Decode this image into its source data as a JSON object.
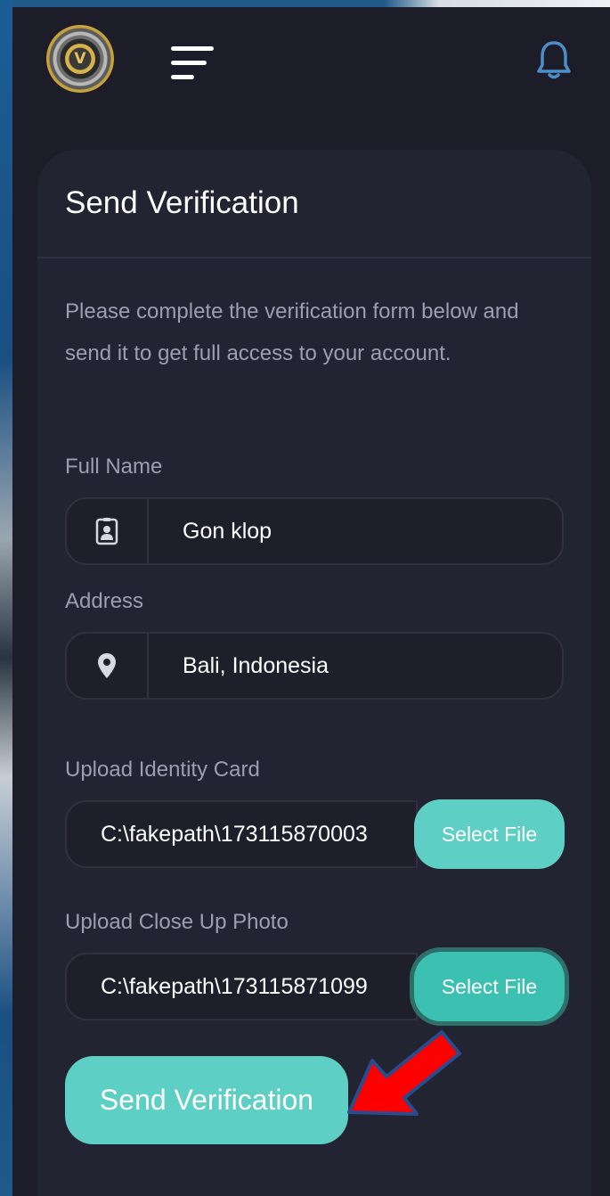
{
  "header": {
    "logo_letter": "V",
    "menu_icon": "hamburger-menu-icon",
    "notification_icon": "bell-icon"
  },
  "card": {
    "title": "Send Verification",
    "intro": "Please complete the verification form below and send it to get full access to your account."
  },
  "form": {
    "full_name": {
      "label": "Full Name",
      "value": "Gon klop",
      "icon": "id-badge-icon"
    },
    "address": {
      "label": "Address",
      "value": "Bali, Indonesia",
      "icon": "map-pin-icon"
    },
    "identity_card": {
      "label": "Upload Identity Card",
      "value": "C:\\fakepath\\173115870003",
      "button": "Select File"
    },
    "close_up_photo": {
      "label": "Upload Close Up Photo",
      "value": "C:\\fakepath\\173115871099",
      "button": "Select File"
    },
    "submit_label": "Send Verification"
  },
  "annotation": {
    "icon": "red-arrow-icon",
    "color": "#ff0000"
  },
  "colors": {
    "accent": "#5ecfc4",
    "background": "#1c1d29",
    "card": "#232432",
    "muted_text": "#9c9fb0"
  }
}
